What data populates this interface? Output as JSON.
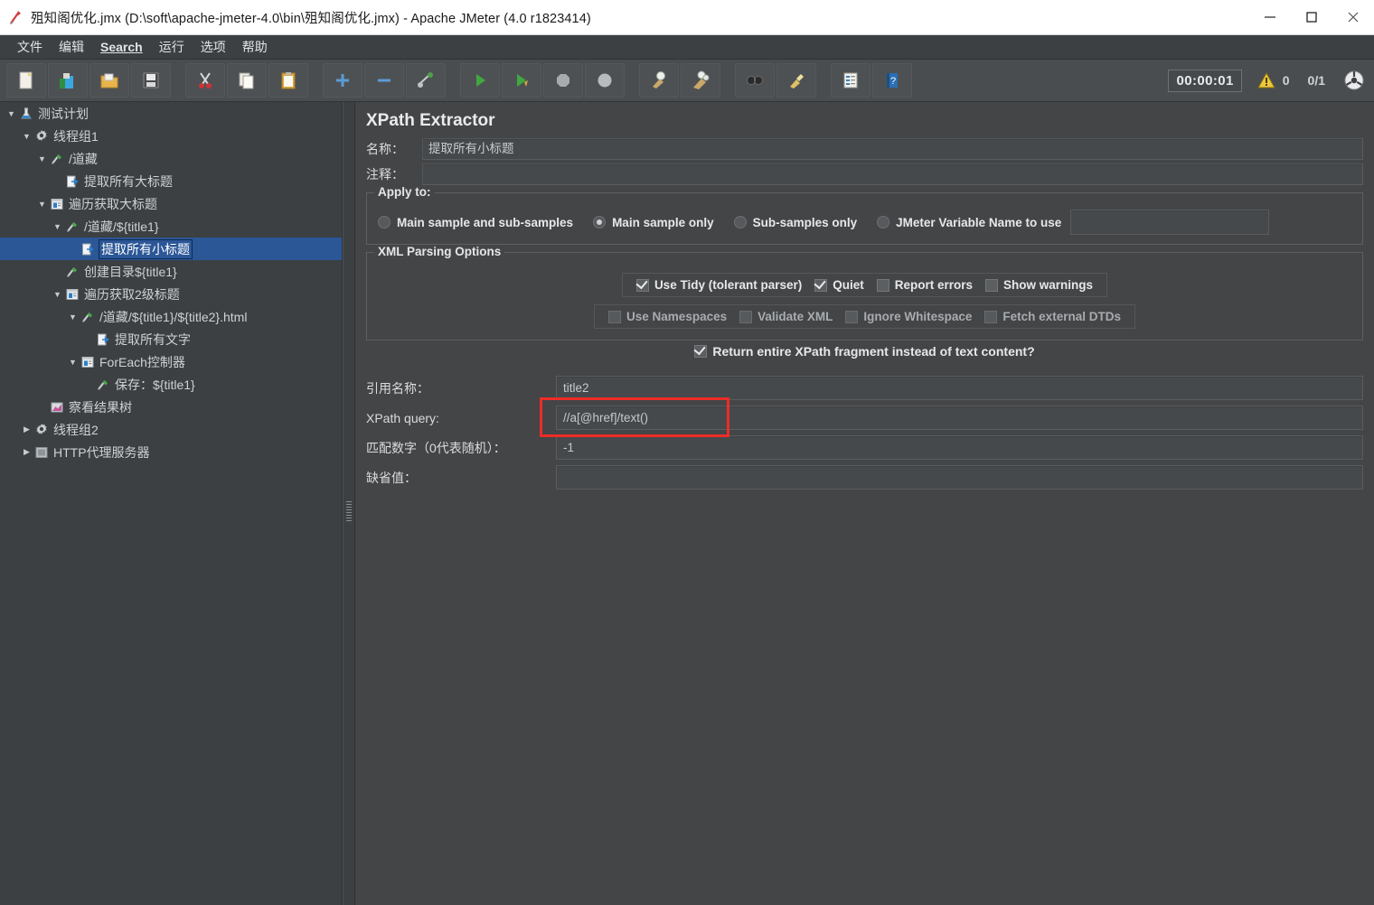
{
  "window": {
    "title": "殂知阁优化.jmx (D:\\soft\\apache-jmeter-4.0\\bin\\殂知阁优化.jmx) - Apache JMeter (4.0 r1823414)",
    "app_icon": "jmeter-feather-icon",
    "minimize_label": "minimize-icon",
    "maximize_label": "maximize-icon",
    "close_label": "close-icon"
  },
  "menu": {
    "items": [
      {
        "label": "文件",
        "underlined": false
      },
      {
        "label": "编辑",
        "underlined": false
      },
      {
        "label": "Search",
        "underlined": true
      },
      {
        "label": "运行",
        "underlined": false
      },
      {
        "label": "选项",
        "underlined": false
      },
      {
        "label": "帮助",
        "underlined": false
      }
    ]
  },
  "toolbar": {
    "buttons": [
      {
        "name": "new-icon",
        "title": "New"
      },
      {
        "name": "templates-icon",
        "title": "Templates"
      },
      {
        "name": "open-icon",
        "title": "Open"
      },
      {
        "name": "save-icon",
        "title": "Save"
      },
      {
        "name": "cut-icon",
        "title": "Cut"
      },
      {
        "name": "copy-icon",
        "title": "Copy"
      },
      {
        "name": "paste-icon",
        "title": "Paste"
      },
      {
        "name": "expand-all-icon",
        "title": "Expand all"
      },
      {
        "name": "collapse-all-icon",
        "title": "Collapse all"
      },
      {
        "name": "toggle-icon",
        "title": "Toggle"
      },
      {
        "name": "start-icon",
        "title": "Start"
      },
      {
        "name": "start-no-pause-icon",
        "title": "Start no pauses"
      },
      {
        "name": "stop-icon",
        "title": "Stop"
      },
      {
        "name": "shutdown-icon",
        "title": "Shutdown"
      },
      {
        "name": "clear-icon",
        "title": "Clear"
      },
      {
        "name": "clear-all-icon",
        "title": "Clear all"
      },
      {
        "name": "search-icon",
        "title": "Search"
      },
      {
        "name": "reset-search-icon",
        "title": "Reset search"
      },
      {
        "name": "function-helper-icon",
        "title": "Function helper"
      },
      {
        "name": "help-icon",
        "title": "Help"
      }
    ],
    "timer": "00:00:01",
    "warning_count": "0",
    "thread_counter": "0/1",
    "warning_icon": "warning-triangle-icon",
    "remote_icon": "remote-engine-icon"
  },
  "tree": {
    "nodes": [
      {
        "label": "测试计划",
        "depth": 0,
        "twisty": "▼",
        "icon": "test-plan-flask-icon",
        "selected": false
      },
      {
        "label": "线程组1",
        "depth": 1,
        "twisty": "▼",
        "icon": "thread-group-gear-icon",
        "selected": false
      },
      {
        "label": "/道藏",
        "depth": 2,
        "twisty": "▼",
        "icon": "http-sampler-pen-icon",
        "selected": false
      },
      {
        "label": "提取所有大标题",
        "depth": 3,
        "twisty": "",
        "icon": "extractor-page-icon",
        "selected": false
      },
      {
        "label": "遍历获取大标题",
        "depth": 2,
        "twisty": "▼",
        "icon": "controller-module-icon",
        "selected": false
      },
      {
        "label": "/道藏/${title1}",
        "depth": 3,
        "twisty": "▼",
        "icon": "http-sampler-pen-icon",
        "selected": false
      },
      {
        "label": "提取所有小标题",
        "depth": 4,
        "twisty": "",
        "icon": "extractor-page-icon",
        "selected": true
      },
      {
        "label": "创建目录${title1}",
        "depth": 3,
        "twisty": "",
        "icon": "http-sampler-pen-icon",
        "selected": false
      },
      {
        "label": "遍历获取2级标题",
        "depth": 3,
        "twisty": "▼",
        "icon": "controller-module-icon",
        "selected": false
      },
      {
        "label": "/道藏/${title1}/${title2}.html",
        "depth": 4,
        "twisty": "▼",
        "icon": "http-sampler-pen-icon",
        "selected": false
      },
      {
        "label": "提取所有文字",
        "depth": 5,
        "twisty": "",
        "icon": "extractor-page-icon",
        "selected": false
      },
      {
        "label": "ForEach控制器",
        "depth": 4,
        "twisty": "▼",
        "icon": "controller-module-icon",
        "selected": false
      },
      {
        "label": "保存：${title1}",
        "depth": 5,
        "twisty": "",
        "icon": "http-sampler-pen-icon",
        "selected": false
      },
      {
        "label": "察看结果树",
        "depth": 2,
        "twisty": "",
        "icon": "view-results-tree-icon",
        "selected": false
      },
      {
        "label": "线程组2",
        "depth": 1,
        "twisty": "▶",
        "icon": "thread-group-gear-icon",
        "selected": false
      },
      {
        "label": "HTTP代理服务器",
        "depth": 1,
        "twisty": "▶",
        "icon": "http-proxy-server-icon",
        "selected": false
      }
    ]
  },
  "panel": {
    "title": "XPath Extractor",
    "name_label": "名称：",
    "name_value": "提取所有小标题",
    "comment_label": "注释：",
    "comment_value": "",
    "apply_to": {
      "legend": "Apply to:",
      "options": [
        {
          "label": "Main sample and sub-samples",
          "selected": false
        },
        {
          "label": "Main sample only",
          "selected": true
        },
        {
          "label": "Sub-samples only",
          "selected": false
        },
        {
          "label": "JMeter Variable Name to use",
          "selected": false
        }
      ],
      "variable_value": ""
    },
    "xml_parsing": {
      "legend": "XML Parsing Options",
      "row1": [
        {
          "label": "Use Tidy (tolerant parser)",
          "checked": true,
          "disabled": false
        },
        {
          "label": "Quiet",
          "checked": true,
          "disabled": false
        },
        {
          "label": "Report errors",
          "checked": false,
          "disabled": false
        },
        {
          "label": "Show warnings",
          "checked": false,
          "disabled": false
        }
      ],
      "row2": [
        {
          "label": "Use Namespaces",
          "checked": false,
          "disabled": true
        },
        {
          "label": "Validate XML",
          "checked": false,
          "disabled": true
        },
        {
          "label": "Ignore Whitespace",
          "checked": false,
          "disabled": true
        },
        {
          "label": "Fetch external DTDs",
          "checked": false,
          "disabled": true
        }
      ]
    },
    "return_fragment": {
      "label": "Return entire XPath fragment instead of text content?",
      "checked": true
    },
    "fields": [
      {
        "label": "引用名称：",
        "value": "title2",
        "name": "reference-name"
      },
      {
        "label": "XPath query:",
        "value": "//a[@href]/text()",
        "name": "xpath-query"
      },
      {
        "label": "匹配数字（0代表随机）：",
        "value": "-1",
        "name": "match-number"
      },
      {
        "label": "缺省值：",
        "value": "",
        "name": "default-value"
      }
    ]
  },
  "annotation": {
    "color": "#ee2b26",
    "target": "xpath-query"
  }
}
